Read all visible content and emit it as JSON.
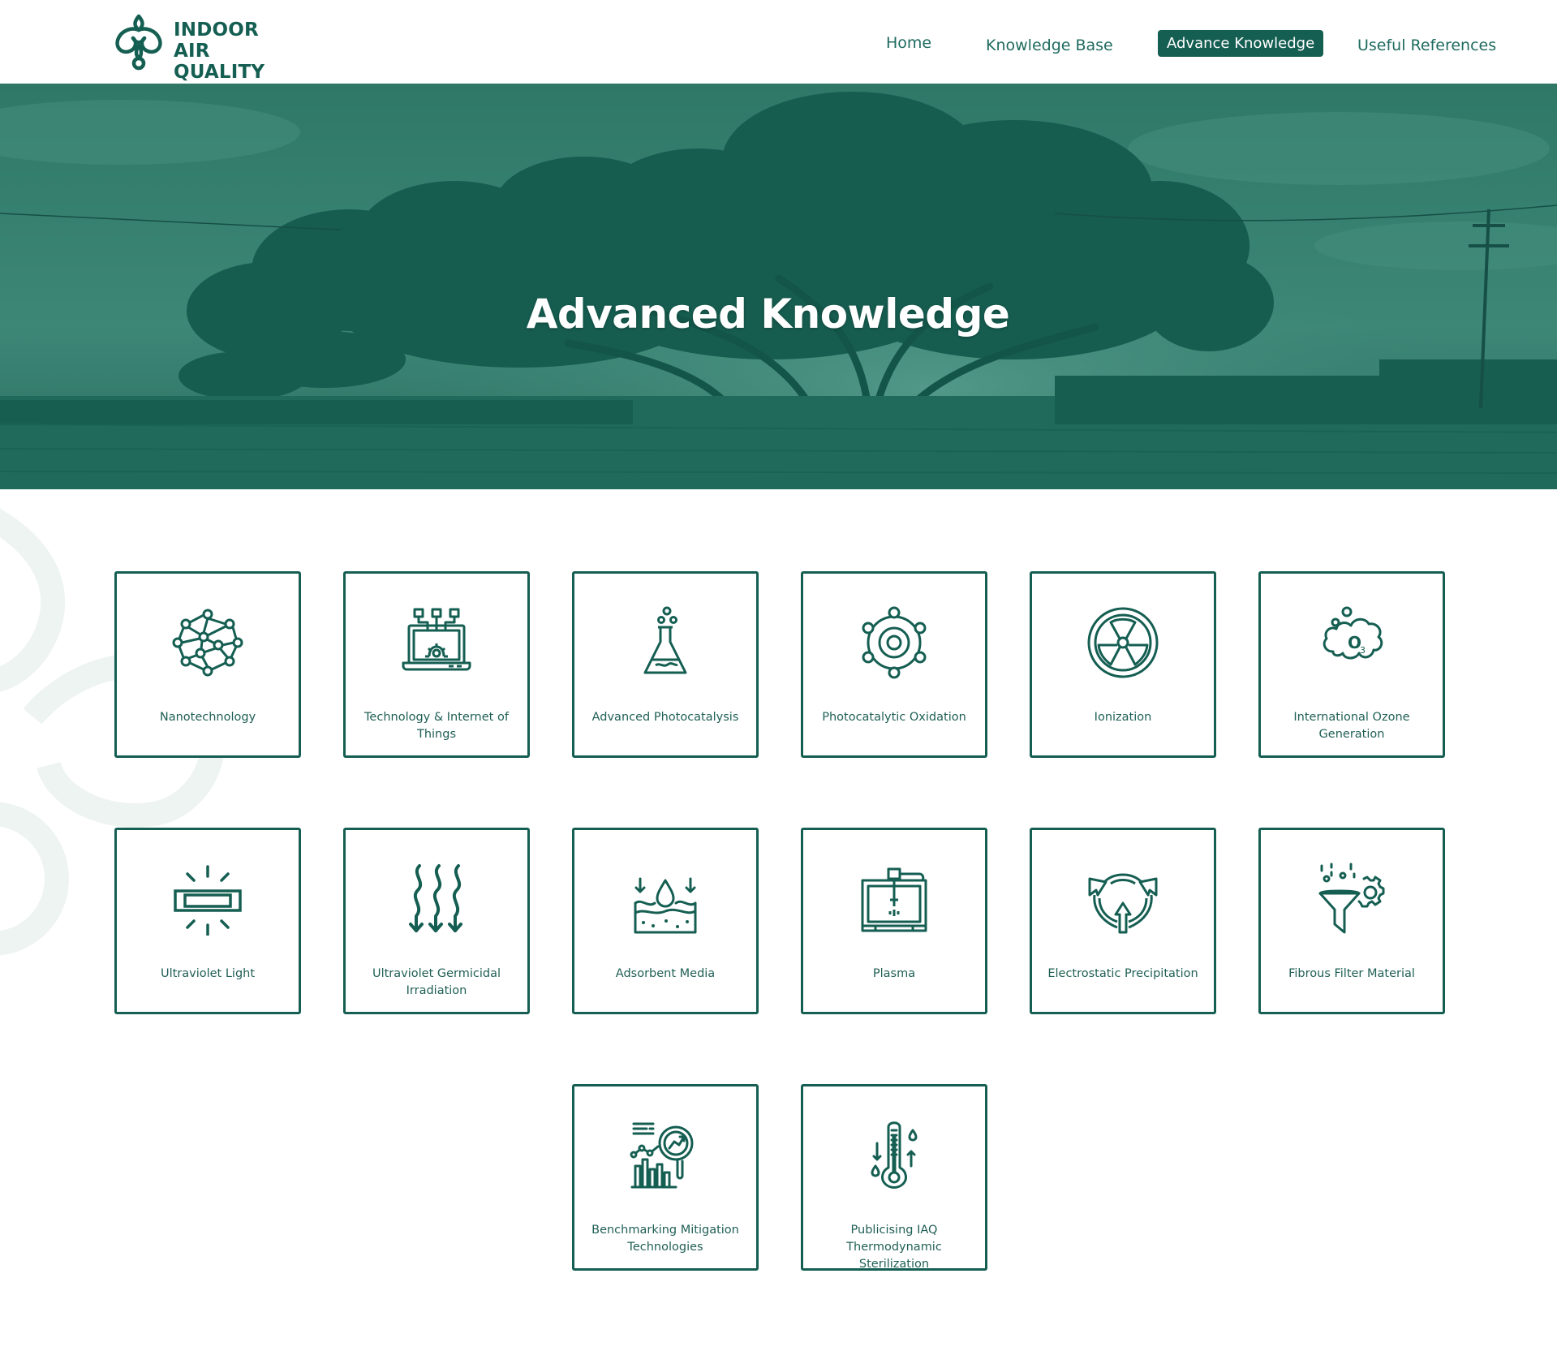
{
  "colors": {
    "brand": "#155e52",
    "hero_overlay": "#2e7566",
    "background": "#ffffff"
  },
  "header": {
    "logo": {
      "line1": "INDOOR AIR",
      "line2": "QUALITY",
      "icon": "leaf-knot-logo"
    },
    "nav": [
      {
        "label": "Home",
        "active": false
      },
      {
        "label": "Knowledge Base",
        "active": false
      },
      {
        "label": "Advance Knowledge",
        "active": true
      },
      {
        "label": "Useful References",
        "active": false
      }
    ]
  },
  "hero": {
    "title": "Advanced Knowledge",
    "image": "tree-silhouette-landscape"
  },
  "cards": [
    {
      "label": "Nanotechnology",
      "icon": "network-sphere-icon"
    },
    {
      "label": "Technology & Internet of Things",
      "icon": "laptop-iot-icon"
    },
    {
      "label": "Advanced Photocatalysis",
      "icon": "flask-icon"
    },
    {
      "label": "Photocatalytic Oxidation",
      "icon": "molecule-orbit-icon"
    },
    {
      "label": "Ionization",
      "icon": "radiation-icon"
    },
    {
      "label": "International Ozone Generation",
      "icon": "ozone-cloud-icon"
    },
    {
      "label": "Ultraviolet Light",
      "icon": "uv-lamp-icon"
    },
    {
      "label": "Ultraviolet Germicidal Irradiation",
      "icon": "heat-waves-icon"
    },
    {
      "label": "Adsorbent Media",
      "icon": "water-droplet-icon"
    },
    {
      "label": "Plasma",
      "icon": "plasma-machine-icon"
    },
    {
      "label": "Electrostatic Precipitation",
      "icon": "circular-arrows-icon"
    },
    {
      "label": "Fibrous Filter Material",
      "icon": "funnel-gear-icon"
    },
    {
      "label": "Benchmarking Mitigation Technologies",
      "icon": "analytics-magnifier-icon"
    },
    {
      "label": "Publicising IAQ Thermodynamic Sterilization",
      "icon": "thermometer-icon"
    }
  ]
}
